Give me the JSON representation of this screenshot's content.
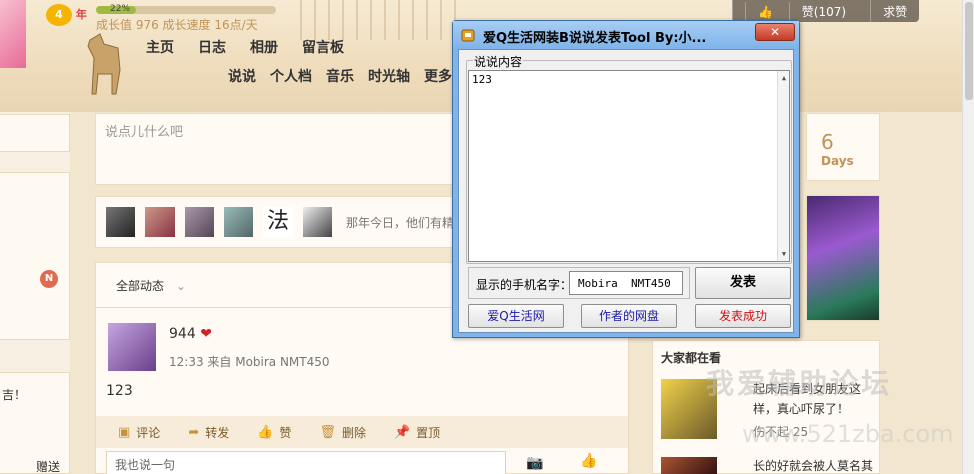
{
  "profile": {
    "level": "4",
    "level_suffix": "年",
    "progress_label": "22%",
    "progress_fraction": 0.22,
    "growth_text": "成长值 976   成长速度 16点/天"
  },
  "nav": {
    "primary": [
      "主页",
      "日志",
      "相册",
      "留言板"
    ],
    "secondary": [
      "说说",
      "个人档",
      "音乐",
      "时光轴",
      "更多"
    ]
  },
  "topbar": {
    "like_label": "赞(107)",
    "extra_label": "求赞"
  },
  "composer": {
    "placeholder": "说点儿什么吧"
  },
  "friends": {
    "tip": "那年今日，他们有精",
    "glyph": "法"
  },
  "feed": {
    "filter_label": "全部动态",
    "post": {
      "author": "944",
      "meta": "12:33  来自 Mobira NMT450",
      "text": "123"
    },
    "actions": [
      "评论",
      "转发",
      "赞",
      "删除",
      "置顶"
    ],
    "comment_placeholder": "我也说一句"
  },
  "sidebar": {
    "days_number": "6",
    "days_label": "Days",
    "watching_title": "大家都在看",
    "watch_item_1": "起床后看到女朋友这样，真心吓尿了！",
    "watch_item_1_sub": "伤不起   25",
    "watch_item_2": "长的好就会被人莫名其"
  },
  "left": {
    "badge": "N",
    "text1": "吉！",
    "text2": "赠送"
  },
  "watermark": {
    "line1": "我爱辅助论坛",
    "line2": "www.521zba.com"
  },
  "tool_window": {
    "title": "爱Q生活网装B说说发表Tool    By:小...",
    "close_label": "✕",
    "group_label": "说说内容",
    "content_value": "123",
    "phone_label": "显示的手机名字：",
    "phone_value": "Mobira  NMT450",
    "post_button": "发表",
    "link1": "爱Q生活网",
    "link2": "作者的网盘",
    "status_button": "发表成功"
  },
  "colors": {
    "accent": "#c09458",
    "window_blue": "#7eb4ea",
    "close_red": "#c43c24"
  }
}
